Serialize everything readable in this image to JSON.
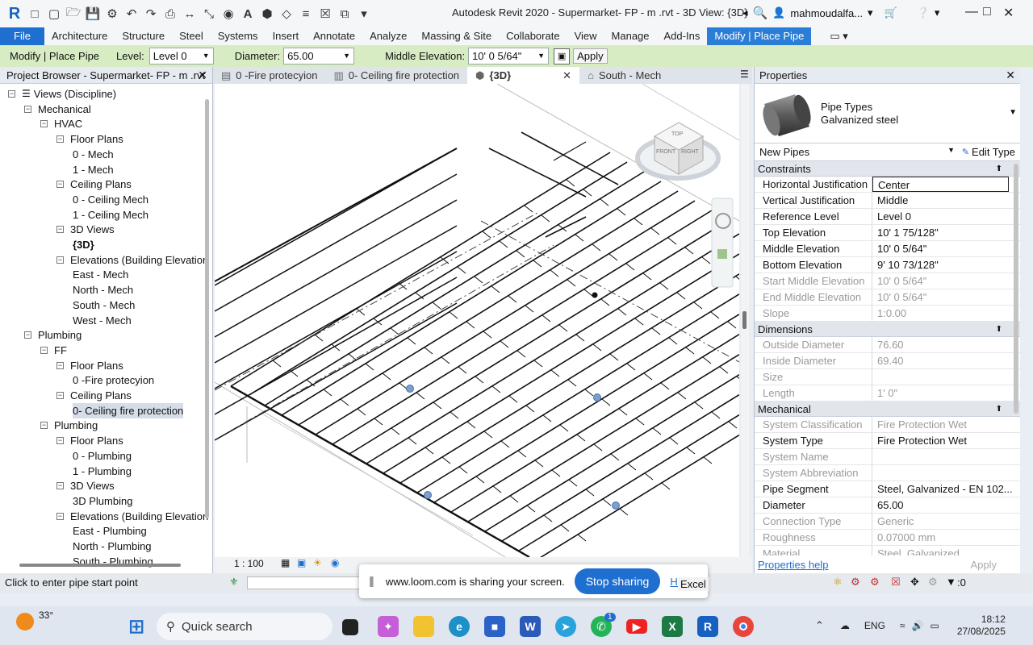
{
  "window": {
    "title": "Autodesk Revit 2020 - Supermarket- FP - m .rvt - 3D View: {3D}",
    "user": "mahmoudalfa..."
  },
  "ribbon": {
    "tabs": [
      "File",
      "Architecture",
      "Structure",
      "Steel",
      "Systems",
      "Insert",
      "Annotate",
      "Analyze",
      "Massing & Site",
      "Collaborate",
      "View",
      "Manage",
      "Add-Ins",
      "Modify | Place Pipe"
    ],
    "active_tab": "Modify | Place Pipe"
  },
  "options_bar": {
    "context": "Modify | Place Pipe",
    "level_label": "Level:",
    "level_value": "Level 0",
    "diameter_label": "Diameter:",
    "diameter_value": "65.00",
    "middle_elev_label": "Middle Elevation:",
    "middle_elev_value": "10'  0 5/64\"",
    "apply_label": "Apply"
  },
  "project_browser": {
    "title": "Project Browser - Supermarket- FP - m .rvt",
    "items": [
      {
        "label": "Views (Discipline)",
        "level": 0,
        "box": "−"
      },
      {
        "label": "Mechanical",
        "level": 1,
        "box": "−"
      },
      {
        "label": "HVAC",
        "level": 2,
        "box": "−"
      },
      {
        "label": "Floor Plans",
        "level": 3,
        "box": "−"
      },
      {
        "label": "0 - Mech",
        "level": 4,
        "box": ""
      },
      {
        "label": "1 - Mech",
        "level": 4,
        "box": ""
      },
      {
        "label": "Ceiling Plans",
        "level": 3,
        "box": "−"
      },
      {
        "label": "0 - Ceiling Mech",
        "level": 4,
        "box": ""
      },
      {
        "label": "1 - Ceiling Mech",
        "level": 4,
        "box": ""
      },
      {
        "label": "3D Views",
        "level": 3,
        "box": "−"
      },
      {
        "label": "{3D}",
        "level": 4,
        "box": "",
        "bold": true
      },
      {
        "label": "Elevations (Building Elevation",
        "level": 3,
        "box": "−"
      },
      {
        "label": "East - Mech",
        "level": 4,
        "box": ""
      },
      {
        "label": "North - Mech",
        "level": 4,
        "box": ""
      },
      {
        "label": "South - Mech",
        "level": 4,
        "box": ""
      },
      {
        "label": "West - Mech",
        "level": 4,
        "box": ""
      },
      {
        "label": "Plumbing",
        "level": 1,
        "box": "−"
      },
      {
        "label": "FF",
        "level": 2,
        "box": "−"
      },
      {
        "label": "Floor Plans",
        "level": 3,
        "box": "−"
      },
      {
        "label": "0 -Fire protecyion",
        "level": 4,
        "box": ""
      },
      {
        "label": "Ceiling Plans",
        "level": 3,
        "box": "−"
      },
      {
        "label": "0- Ceiling fire protection",
        "level": 4,
        "box": "",
        "selected": true
      },
      {
        "label": "Plumbing",
        "level": 2,
        "box": "−"
      },
      {
        "label": "Floor Plans",
        "level": 3,
        "box": "−"
      },
      {
        "label": "0 - Plumbing",
        "level": 4,
        "box": ""
      },
      {
        "label": "1 - Plumbing",
        "level": 4,
        "box": ""
      },
      {
        "label": "3D Views",
        "level": 3,
        "box": "−"
      },
      {
        "label": "3D Plumbing",
        "level": 4,
        "box": ""
      },
      {
        "label": "Elevations (Building Elevation",
        "level": 3,
        "box": "−"
      },
      {
        "label": "East - Plumbing",
        "level": 4,
        "box": ""
      },
      {
        "label": "North - Plumbing",
        "level": 4,
        "box": ""
      },
      {
        "label": "South - Plumbing",
        "level": 4,
        "box": ""
      }
    ]
  },
  "view_tabs": [
    {
      "label": "0 -Fire protecyion",
      "icon": "floor-plan-icon"
    },
    {
      "label": "0- Ceiling fire protection",
      "icon": "ceiling-plan-icon"
    },
    {
      "label": "{3D}",
      "icon": "3d-view-icon",
      "active": true
    },
    {
      "label": "South - Mech",
      "icon": "elevation-icon"
    }
  ],
  "view_control": {
    "scale": "1 : 100"
  },
  "viewcube": {
    "top": "TOP",
    "front": "FRONT",
    "right": "RIGHT"
  },
  "properties": {
    "title": "Properties",
    "family": "Pipe Types",
    "type": "Galvanized steel",
    "instance_filter": "New Pipes",
    "edit_type": "Edit Type",
    "sections": [
      {
        "name": "Constraints",
        "rows": [
          {
            "k": "Horizontal Justification",
            "v": "Center",
            "boxed": true
          },
          {
            "k": "Vertical Justification",
            "v": "Middle"
          },
          {
            "k": "Reference Level",
            "v": "Level 0"
          },
          {
            "k": "Top Elevation",
            "v": "10'  1 75/128\""
          },
          {
            "k": "Middle Elevation",
            "v": "10'  0 5/64\""
          },
          {
            "k": "Bottom Elevation",
            "v": "9'  10 73/128\""
          },
          {
            "k": "Start Middle Elevation",
            "v": "10'  0 5/64\"",
            "dim": true
          },
          {
            "k": "End Middle Elevation",
            "v": "10'  0 5/64\"",
            "dim": true
          },
          {
            "k": "Slope",
            "v": "1:0.00",
            "dim": true
          }
        ]
      },
      {
        "name": "Dimensions",
        "rows": [
          {
            "k": "Outside Diameter",
            "v": "76.60",
            "dim": true
          },
          {
            "k": "Inside Diameter",
            "v": "69.40",
            "dim": true
          },
          {
            "k": "Size",
            "v": "",
            "dim": true
          },
          {
            "k": "Length",
            "v": "1'  0\"",
            "dim": true
          }
        ]
      },
      {
        "name": "Mechanical",
        "rows": [
          {
            "k": "System Classification",
            "v": "Fire Protection Wet",
            "dim": true
          },
          {
            "k": "System Type",
            "v": "Fire Protection Wet"
          },
          {
            "k": "System Name",
            "v": "",
            "dim": true
          },
          {
            "k": "System Abbreviation",
            "v": "",
            "dim": true
          },
          {
            "k": "Pipe Segment",
            "v": "Steel, Galvanized - EN 102..."
          },
          {
            "k": "Diameter",
            "v": "65.00"
          },
          {
            "k": "Connection Type",
            "v": "Generic",
            "dim": true
          },
          {
            "k": "Roughness",
            "v": "0.07000 mm",
            "dim": true
          },
          {
            "k": "Material",
            "v": "Steel, Galvanized",
            "dim": true
          }
        ]
      }
    ],
    "help_link": "Properties help",
    "apply_label": "Apply"
  },
  "status_bar": {
    "prompt": "Click to enter pipe start point",
    "filter_count": ":0"
  },
  "loom_bar": {
    "message": "www.loom.com is sharing your screen.",
    "stop_label": "Stop sharing",
    "hide_label": "Hide",
    "app_label": "Excel"
  },
  "taskbar": {
    "weather": "33°",
    "search_placeholder": "Quick search",
    "lang": "ENG",
    "time": "18:12",
    "date": "27/08/2025",
    "whatsapp_badge": "1"
  }
}
